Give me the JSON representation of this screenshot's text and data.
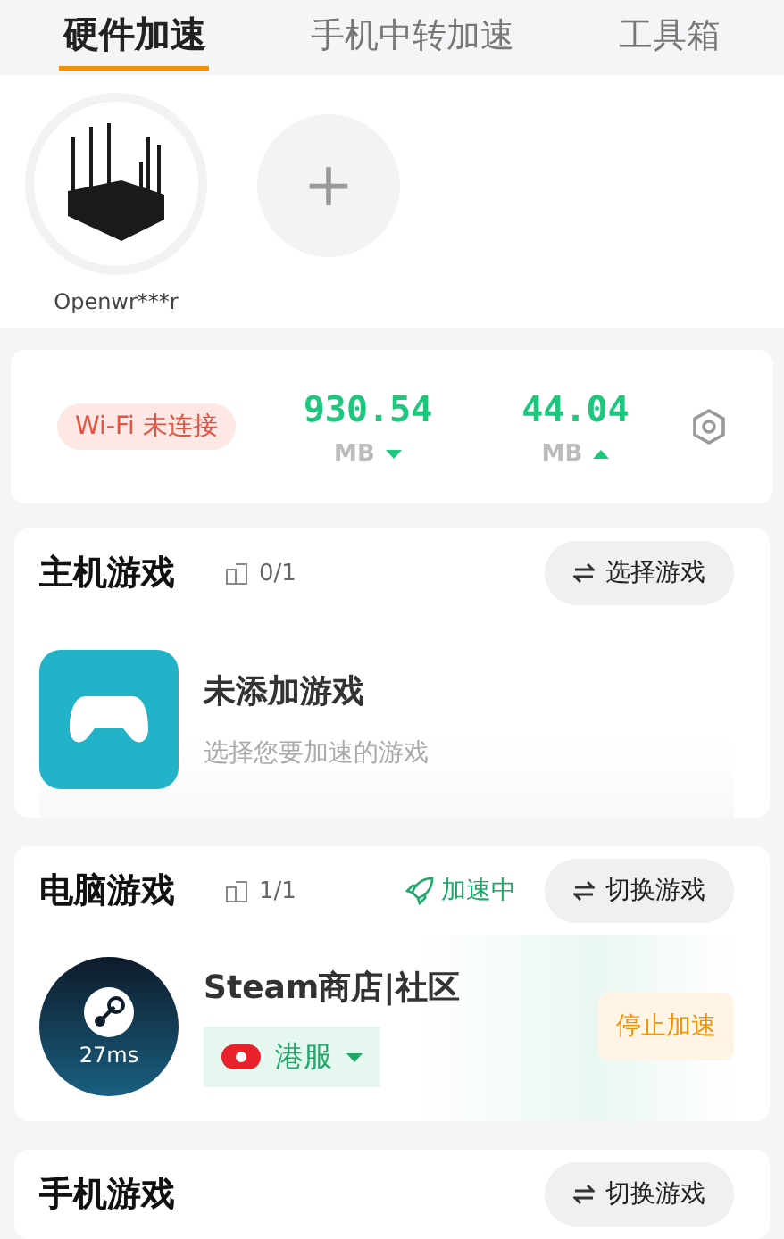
{
  "tabs": [
    {
      "label": "硬件加速",
      "selected": true
    },
    {
      "label": "手机中转加速",
      "selected": false
    },
    {
      "label": "工具箱",
      "selected": false
    }
  ],
  "devices": [
    {
      "kind": "router",
      "name": "Openwr***r"
    },
    {
      "kind": "add",
      "label": "+"
    }
  ],
  "stats": {
    "wifi_status": "Wi-Fi 未连接",
    "download": {
      "value": "930.54",
      "unit": "MB"
    },
    "upload": {
      "value": "44.04",
      "unit": "MB"
    }
  },
  "sections": [
    {
      "kind": "console",
      "title": "主机游戏",
      "count": "0/1",
      "action": "选择游戏",
      "game": {
        "name": "未添加游戏",
        "hint": "选择您要加速的游戏"
      }
    },
    {
      "kind": "pc",
      "title": "电脑游戏",
      "count": "1/1",
      "status": "加速中",
      "action": "切换游戏",
      "game": {
        "name": "Steam商店|社区",
        "latency": "27ms",
        "region": "港服",
        "stop": "停止加速"
      }
    },
    {
      "kind": "mobile",
      "title": "手机游戏",
      "action": "切换游戏"
    }
  ]
}
